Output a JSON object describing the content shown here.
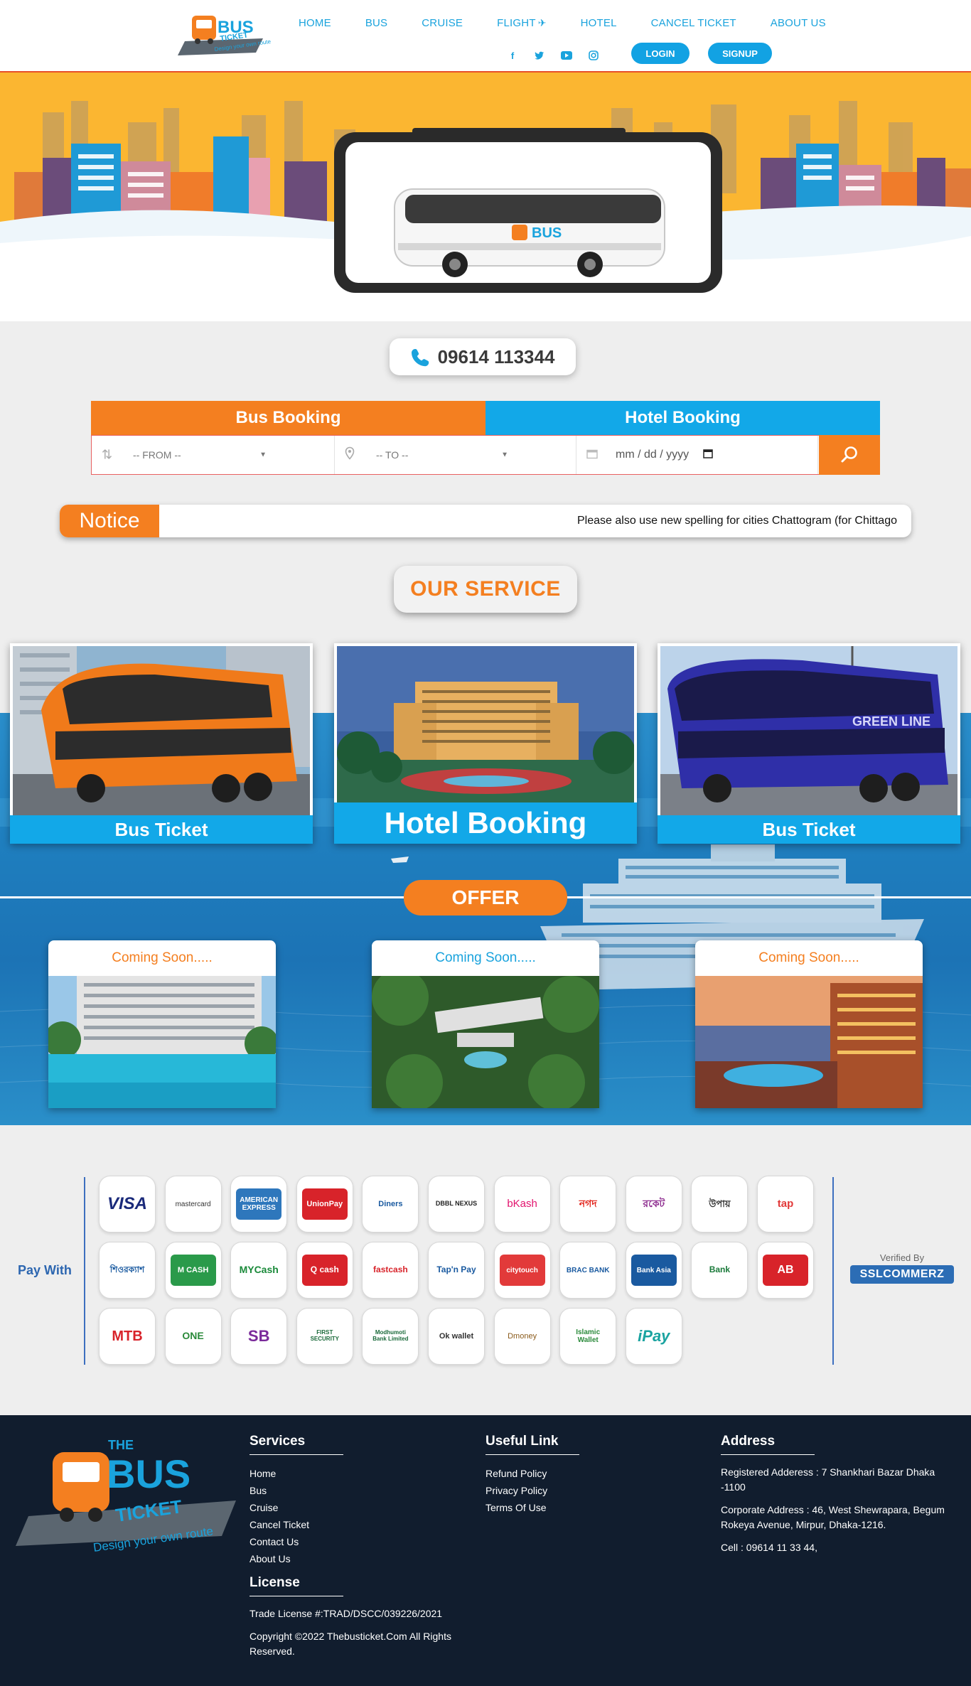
{
  "header": {
    "logo_alt": "The Bus Ticket",
    "logo_tagline": "Design your own route",
    "nav": [
      "HOME",
      "BUS",
      "CRUISE",
      "FLIGHT",
      "HOTEL",
      "CANCEL TICKET",
      "ABOUT US"
    ],
    "social_icons": [
      "facebook-icon",
      "twitter-icon",
      "youtube-icon",
      "instagram-icon"
    ],
    "login_label": "LOGIN",
    "signup_label": "SIGNUP"
  },
  "phone": {
    "number": "09614 113344"
  },
  "booking": {
    "tabs": [
      "Bus Booking",
      "Hotel Booking"
    ],
    "from_placeholder": "-- FROM --",
    "to_placeholder": "-- TO --",
    "date_placeholder": "mm / dd / yyyy"
  },
  "notice": {
    "label": "Notice",
    "text": "Please also use new spelling for cities Chattogram (for Chittago"
  },
  "our_service": {
    "title": "OUR SERVICE",
    "cards": [
      "Bus Ticket",
      "Hotel Booking",
      "Bus Ticket"
    ]
  },
  "offer": {
    "title": "OFFER",
    "cards": [
      "Coming Soon.....",
      "Coming Soon.....",
      "Coming Soon....."
    ]
  },
  "payments": {
    "label": "Pay With",
    "verified_by": "Verified By",
    "verifier": "SSLCOMMERZ",
    "methods": [
      "VISA",
      "mastercard",
      "AMERICAN EXPRESS",
      "UnionPay",
      "Diners",
      "DBBL NEXUS",
      "bKash",
      "নগদ",
      "রকেট",
      "উপায়",
      "tap",
      "শিওরক্যাশ",
      "M CASH",
      "MYCash",
      "Q cash",
      "fastcash",
      "Tap'n Pay",
      "citytouch",
      "BRAC BANK",
      "Bank Asia",
      "Bank",
      "AB",
      "MTB",
      "ONE",
      "SB",
      "FIRST SECURITY",
      "Modhumoti Bank Limited",
      "Ok wallet",
      "Dmoney",
      "Islamic Wallet",
      "iPay"
    ]
  },
  "footer": {
    "services": {
      "title": "Services",
      "links": [
        "Home",
        "Bus",
        "Cruise",
        "Cancel Ticket",
        "Contact Us",
        "About Us"
      ]
    },
    "useful": {
      "title": "Useful Link",
      "links": [
        "Refund Policy",
        "Privacy Policy",
        "Terms Of Use"
      ]
    },
    "address": {
      "title": "Address",
      "registered": "Registered Adderess : 7 Shankhari Bazar Dhaka -1100",
      "corporate": "Corporate Address : 46, West Shewrapara, Begum Rokeya Avenue, Mirpur, Dhaka-1216.",
      "cell": "Cell : 09614 11 33 44,"
    },
    "license": {
      "title": "License",
      "trade": "Trade License #:TRAD/DSCC/039226/2021",
      "copyright": "Copyright ©2022 Thebusticket.Com All Rights Reserved."
    }
  },
  "colors": {
    "orange": "#f47f20",
    "blue": "#12a8e8",
    "footer_bg": "#111d2e",
    "hero_bg": "#fbb631"
  }
}
